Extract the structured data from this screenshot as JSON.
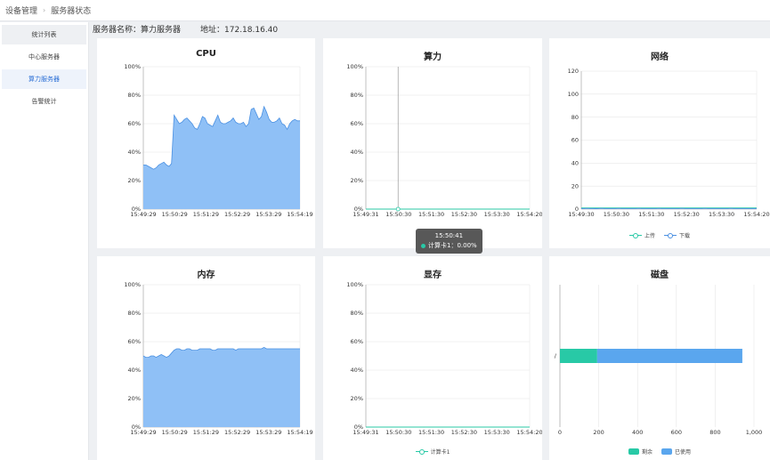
{
  "breadcrumb": {
    "items": [
      "设备管理",
      "服务器状态"
    ]
  },
  "sidebar": {
    "items": [
      {
        "label": "统计列表",
        "kind": "header"
      },
      {
        "label": "中心服务器",
        "kind": "normal"
      },
      {
        "label": "算力服务器",
        "kind": "active"
      },
      {
        "label": "告警统计",
        "kind": "normal"
      }
    ]
  },
  "server": {
    "name": "服务器名称：算力服务器",
    "address": "地址：172.18.16.40"
  },
  "colors": {
    "blue_fill": "#8fc0f6",
    "blue_line": "#4a90e2",
    "teal": "#28c9a6",
    "grid": "#e6e6e6"
  },
  "chart_data": [
    {
      "id": "cpu",
      "type": "area",
      "title": "CPU",
      "x": [
        "15:49:29",
        "15:50:29",
        "15:51:29",
        "15:52:29",
        "15:53:29",
        "15:54:19"
      ],
      "ylim": [
        0,
        100
      ],
      "yticks": [
        "0%",
        "20%",
        "40%",
        "60%",
        "80%",
        "100%"
      ],
      "series": [
        {
          "values": [
            31,
            31,
            30,
            29,
            28,
            29,
            31,
            32,
            33,
            31,
            30,
            32,
            66,
            63,
            60,
            61,
            63,
            64,
            62,
            60,
            57,
            56,
            60,
            65,
            64,
            60,
            59,
            58,
            62,
            66,
            61,
            60,
            60,
            61,
            62,
            64,
            61,
            60,
            60,
            61,
            58,
            60,
            70,
            71,
            67,
            63,
            65,
            72,
            68,
            63,
            61,
            61,
            62,
            64,
            60,
            59,
            56,
            60,
            62,
            63,
            62,
            62
          ]
        }
      ]
    },
    {
      "id": "compute",
      "type": "line",
      "title": "算力",
      "x": [
        "15:49:31",
        "15:50:30",
        "15:51:30",
        "15:52:30",
        "15:53:30",
        "15:54:20"
      ],
      "ylim": [
        0,
        100
      ],
      "yticks": [
        "0%",
        "20%",
        "40%",
        "60%",
        "80%",
        "100%"
      ],
      "series": [
        {
          "name": "计算卡1",
          "values": [
            0,
            0,
            0,
            0,
            0,
            0,
            0,
            0,
            0,
            0,
            0,
            0,
            0,
            0,
            0,
            0,
            0,
            0,
            0,
            0,
            0,
            0,
            0,
            0,
            0,
            0,
            0,
            0,
            0,
            0,
            0,
            0,
            0,
            0,
            0,
            0,
            0,
            0,
            0,
            0,
            0,
            0,
            0,
            0,
            0,
            0,
            0,
            0,
            0,
            0,
            0,
            0,
            0,
            0,
            0,
            0,
            0,
            0,
            0,
            0,
            0,
            0
          ]
        }
      ],
      "tooltip": {
        "time": "15:50:41",
        "label": "计算卡1：0.00%",
        "index": 12
      }
    },
    {
      "id": "network",
      "type": "line",
      "title": "网络",
      "x": [
        "15:49:30",
        "15:50:30",
        "15:51:30",
        "15:52:30",
        "15:53:30",
        "15:54:20"
      ],
      "ylim": [
        0,
        120
      ],
      "yticks": [
        "0",
        "20",
        "40",
        "60",
        "80",
        "100",
        "120"
      ],
      "series": [
        {
          "name": "上传",
          "values": [
            1,
            1,
            1,
            1,
            1,
            1,
            1,
            1,
            1,
            1,
            1,
            1,
            1,
            1,
            1,
            1,
            1,
            1,
            1,
            1,
            1,
            1,
            1,
            1,
            1,
            1,
            1,
            1,
            1,
            1,
            1,
            1,
            1,
            1,
            1,
            1,
            1,
            1,
            1,
            1,
            1,
            1,
            1,
            1,
            1,
            1,
            1,
            1,
            1,
            1,
            1,
            1,
            1,
            1,
            1,
            1,
            1,
            1,
            1,
            1,
            1,
            1
          ]
        },
        {
          "name": "下载",
          "values": [
            0.5,
            0.5,
            0.6,
            0.5,
            0.5,
            0.4,
            0.5,
            0.6,
            0.5,
            0.5,
            0.5,
            0.5,
            0.5,
            0.6,
            0.5,
            0.5,
            0.5,
            0.5,
            0.5,
            0.5,
            0.6,
            0.5,
            0.5,
            0.5,
            0.5,
            0.5,
            0.5,
            0.6,
            0.5,
            0.5,
            0.5,
            0.5,
            0.5,
            0.5,
            0.5,
            0.6,
            0.5,
            0.5,
            0.5,
            0.5,
            0.5,
            0.5,
            0.5,
            0.6,
            0.5,
            0.5,
            0.5,
            0.5,
            0.5,
            0.5,
            0.5,
            0.5,
            0.6,
            0.5,
            0.5,
            0.5,
            0.5,
            0.5,
            0.5,
            0.5,
            0.5,
            0.5
          ]
        }
      ]
    },
    {
      "id": "memory",
      "type": "area",
      "title": "内存",
      "x": [
        "15:49:29",
        "15:50:29",
        "15:51:29",
        "15:52:29",
        "15:53:29",
        "15:54:19"
      ],
      "ylim": [
        0,
        100
      ],
      "yticks": [
        "0%",
        "20%",
        "40%",
        "60%",
        "80%",
        "100%"
      ],
      "series": [
        {
          "values": [
            50,
            49,
            49,
            50,
            50,
            49,
            50,
            51,
            50,
            49,
            50,
            52,
            54,
            55,
            55,
            54,
            54,
            55,
            55,
            54,
            54,
            54,
            55,
            55,
            55,
            55,
            55,
            54,
            54,
            55,
            55,
            55,
            55,
            55,
            55,
            55,
            54,
            55,
            55,
            55,
            55,
            55,
            55,
            55,
            55,
            55,
            55,
            56,
            55,
            55,
            55,
            55,
            55,
            55,
            55,
            55,
            55,
            55,
            55,
            55,
            55,
            55
          ]
        }
      ]
    },
    {
      "id": "vram",
      "type": "line",
      "title": "显存",
      "x": [
        "15:49:31",
        "15:50:30",
        "15:51:30",
        "15:52:30",
        "15:53:30",
        "15:54:20"
      ],
      "ylim": [
        0,
        100
      ],
      "yticks": [
        "0%",
        "20%",
        "40%",
        "60%",
        "80%",
        "100%"
      ],
      "series": [
        {
          "name": "计算卡1",
          "values": [
            0,
            0,
            0,
            0,
            0,
            0,
            0,
            0,
            0,
            0,
            0,
            0,
            0,
            0,
            0,
            0,
            0,
            0,
            0,
            0,
            0,
            0,
            0,
            0,
            0,
            0,
            0,
            0,
            0,
            0,
            0,
            0,
            0,
            0,
            0,
            0,
            0,
            0,
            0,
            0,
            0,
            0,
            0,
            0,
            0,
            0,
            0,
            0,
            0,
            0,
            0,
            0,
            0,
            0,
            0,
            0,
            0,
            0,
            0,
            0,
            0,
            0
          ]
        }
      ]
    },
    {
      "id": "disk",
      "type": "bar",
      "title": "磁盘",
      "orientation": "horizontal",
      "stacked": true,
      "categories": [
        "/"
      ],
      "xlim": [
        0,
        1000
      ],
      "xticks": [
        "0",
        "200",
        "400",
        "600",
        "800",
        "1,000"
      ],
      "series": [
        {
          "name": "剩余",
          "values": [
            192
          ]
        },
        {
          "name": "已使用",
          "values": [
            748
          ]
        }
      ]
    }
  ]
}
